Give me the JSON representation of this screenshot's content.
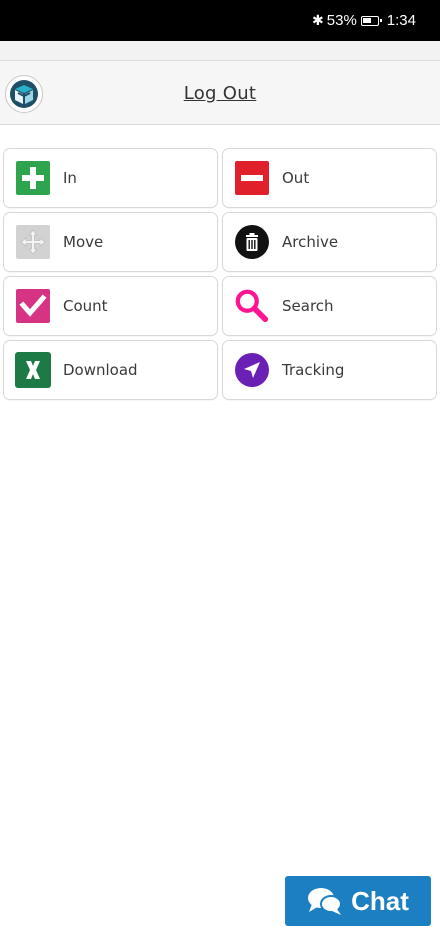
{
  "status_bar": {
    "battery": "53%",
    "time": "1:34",
    "icons": [
      "bluetooth-icon",
      "battery-icon"
    ]
  },
  "header": {
    "logout_label": "Log Out",
    "logo_icon": "box-logo-icon"
  },
  "tiles": [
    {
      "label": "In",
      "icon": "plus-icon",
      "color": "#2ea44f"
    },
    {
      "label": "Out",
      "icon": "minus-icon",
      "color": "#e0202a"
    },
    {
      "label": "Move",
      "icon": "move-arrows-icon",
      "color": "#c8c8c8"
    },
    {
      "label": "Archive",
      "icon": "trash-icon",
      "color": "#111111"
    },
    {
      "label": "Count",
      "icon": "checkbox-icon",
      "color": "#d63384"
    },
    {
      "label": "Search",
      "icon": "search-icon",
      "color": "#ff1493"
    },
    {
      "label": "Download",
      "icon": "excel-icon",
      "color": "#1e7a45"
    },
    {
      "label": "Tracking",
      "icon": "navigation-icon",
      "color": "#6a1fb5"
    }
  ],
  "chat": {
    "label": "Chat",
    "icon": "chat-bubbles-icon",
    "color": "#1b7fc2"
  }
}
